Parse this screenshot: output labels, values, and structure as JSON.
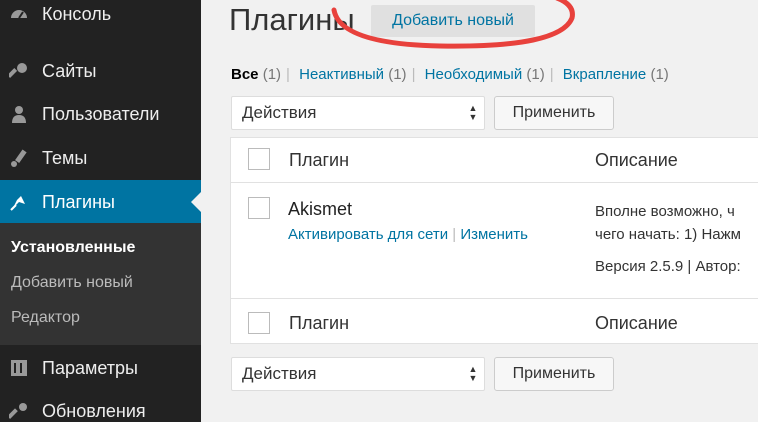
{
  "sidebar": {
    "items": [
      {
        "label": "Консоль",
        "icon": "dashboard-icon"
      },
      {
        "label": "Сайты",
        "icon": "key-icon"
      },
      {
        "label": "Пользователи",
        "icon": "user-icon"
      },
      {
        "label": "Темы",
        "icon": "brush-icon"
      },
      {
        "label": "Плагины",
        "icon": "plugin-icon",
        "active": true
      },
      {
        "label": "Параметры",
        "icon": "settings-icon"
      },
      {
        "label": "Обновления",
        "icon": "wrench-icon"
      }
    ],
    "submenu": [
      "Установленные",
      "Добавить новый",
      "Редактор"
    ]
  },
  "header": {
    "title": "Плагины",
    "add_new": "Добавить новый"
  },
  "filters": [
    {
      "label": "Все",
      "count": "(1)"
    },
    {
      "label": "Неактивный",
      "count": "(1)"
    },
    {
      "label": "Необходимый",
      "count": "(1)"
    },
    {
      "label": "Вкрапление",
      "count": "(1)"
    }
  ],
  "bulk": {
    "select_value": "Действия",
    "apply": "Применить"
  },
  "table": {
    "col_plugin": "Плагин",
    "col_desc": "Описание",
    "plugin": {
      "name": "Akismet",
      "action_activate": "Активировать для сети",
      "action_sep": "|",
      "action_edit": "Изменить",
      "desc_line1": "Вполне возможно, ч",
      "desc_line2": "чего начать: 1) Нажм",
      "meta": "Версия 2.5.9 | Автор:"
    }
  },
  "colors": {
    "sidebar_bg": "#222222",
    "active_bg": "#0074a2",
    "link": "#0074a2",
    "annotation": "#e8413c"
  }
}
